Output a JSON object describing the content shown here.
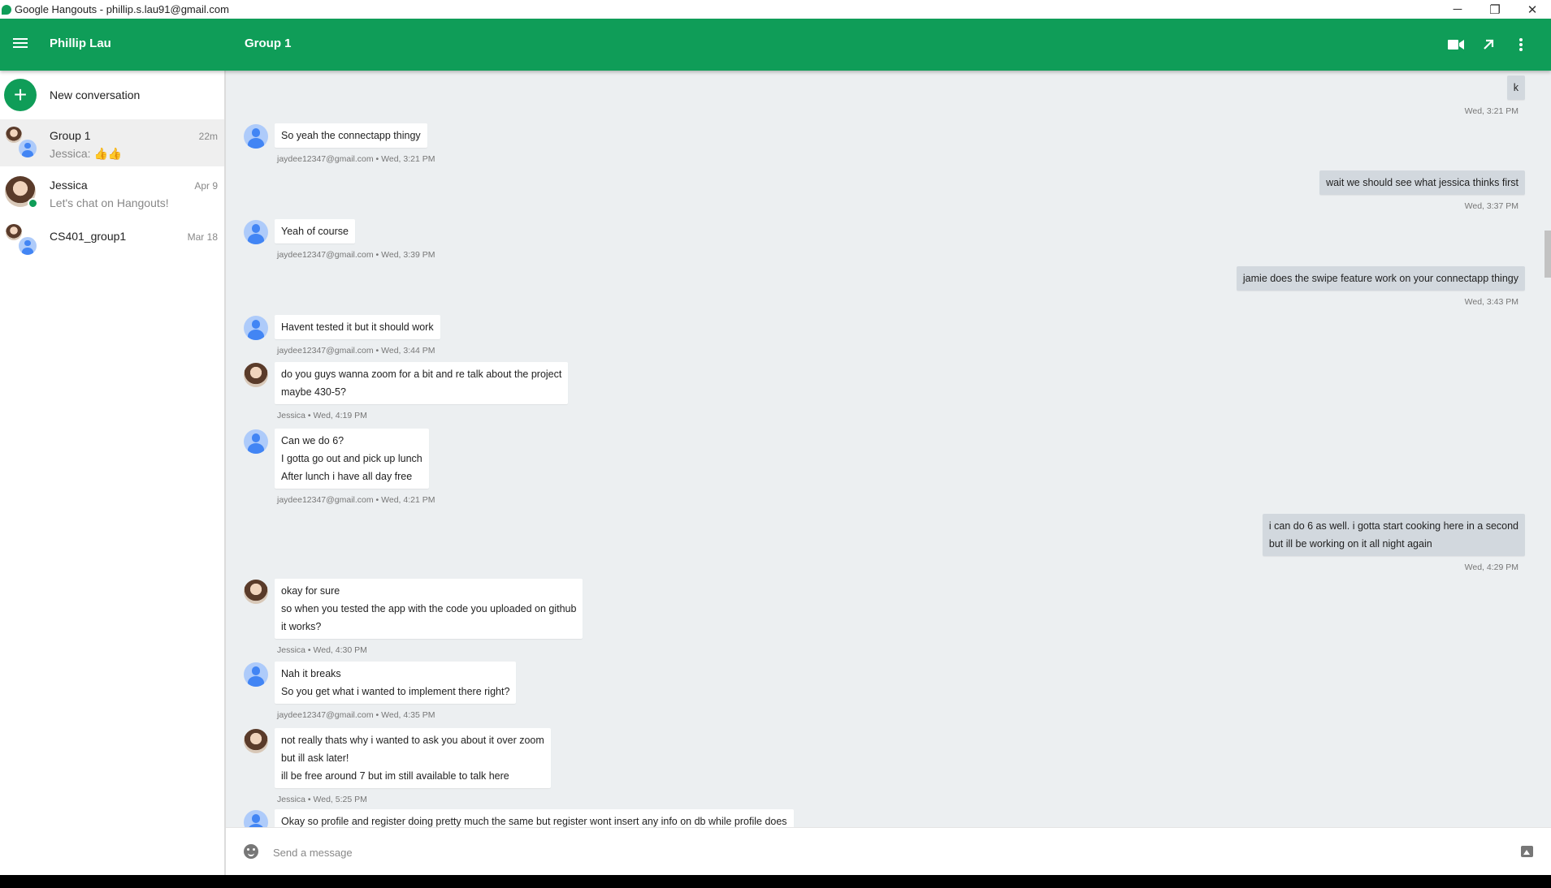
{
  "window": {
    "title": "Google Hangouts - phillip.s.lau91@gmail.com",
    "controls": {
      "minimize": "─",
      "restore": "❐",
      "close": "✕"
    }
  },
  "header": {
    "user_name": "Phillip Lau",
    "conversation_title": "Group 1",
    "icons": [
      "menu-icon",
      "video-call-icon",
      "pop-out-icon",
      "more-options-icon"
    ]
  },
  "sidebar": {
    "new_conversation": {
      "icon": "+",
      "label": "New conversation"
    },
    "conversations": [
      {
        "name": "Group 1",
        "snippet": "Jessica: 👍👍",
        "time": "22m",
        "active": true
      },
      {
        "name": "Jessica",
        "snippet": "Let's chat on Hangouts!",
        "time": "Apr 9",
        "active": false
      },
      {
        "name": "CS401_group1",
        "snippet": "",
        "time": "Mar 18",
        "active": false
      }
    ]
  },
  "messages": [
    {
      "side": "right",
      "lines": [
        "k"
      ],
      "meta": "Wed, 3:21 PM"
    },
    {
      "side": "left",
      "sender": "jaydee",
      "lines": [
        "So yeah the connectapp thingy"
      ],
      "meta": "jaydee12347@gmail.com • Wed, 3:21 PM"
    },
    {
      "side": "right",
      "lines": [
        "wait we should see what jessica thinks first"
      ],
      "meta": "Wed, 3:37 PM"
    },
    {
      "side": "left",
      "sender": "jaydee",
      "lines": [
        "Yeah of course"
      ],
      "meta": "jaydee12347@gmail.com • Wed, 3:39 PM"
    },
    {
      "side": "right",
      "lines": [
        "jamie does the swipe feature work on your connectapp thingy"
      ],
      "meta": "Wed, 3:43 PM"
    },
    {
      "side": "left",
      "sender": "jaydee",
      "lines": [
        "Havent tested it but it should work"
      ],
      "meta": "jaydee12347@gmail.com • Wed, 3:44 PM"
    },
    {
      "side": "left",
      "sender": "jessica",
      "lines": [
        "do you guys wanna zoom for a bit and re talk about the project",
        "maybe 430-5?"
      ],
      "meta": "Jessica • Wed, 4:19 PM"
    },
    {
      "side": "left",
      "sender": "jaydee",
      "lines": [
        "Can we do 6?",
        "I gotta go out and pick up lunch",
        "After lunch i have all day free"
      ],
      "meta": "jaydee12347@gmail.com • Wed, 4:21 PM"
    },
    {
      "side": "right",
      "lines": [
        "i can do 6 as well. i gotta start cooking here in a second",
        "but ill be working on it all night again"
      ],
      "meta": "Wed, 4:29 PM"
    },
    {
      "side": "left",
      "sender": "jessica",
      "lines": [
        "okay for sure",
        "so when you tested the app with the code you uploaded on github",
        "it works?"
      ],
      "meta": "Jessica • Wed, 4:30 PM"
    },
    {
      "side": "left",
      "sender": "jaydee",
      "lines": [
        "Nah it breaks",
        "So you get what i wanted to implement there right?"
      ],
      "meta": "jaydee12347@gmail.com • Wed, 4:35 PM"
    },
    {
      "side": "left",
      "sender": "jessica",
      "lines": [
        "not really thats why i wanted to ask you about it over zoom",
        "but ill ask later!",
        "ill be free around 7 but im still available to talk here"
      ],
      "meta": "Jessica • Wed, 5:25 PM"
    },
    {
      "side": "left",
      "sender": "jaydee",
      "lines": [
        "Okay so profile and register doing pretty much the same but register wont insert any info on db while profile does"
      ],
      "meta": ""
    }
  ],
  "compose": {
    "placeholder": "Send a message",
    "value": "",
    "icons": [
      "emoji-icon",
      "image-icon"
    ]
  },
  "colors": {
    "header_green": "#0f9d58",
    "chat_background": "#eceff1",
    "own_bubble": "#d2d8de"
  }
}
